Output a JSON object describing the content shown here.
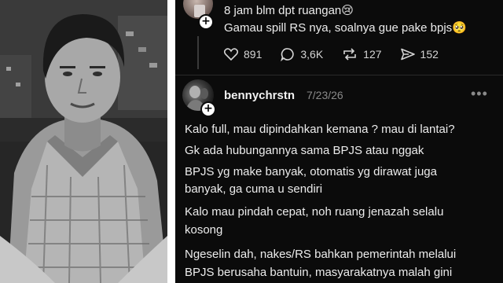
{
  "photo": {
    "description_icon": "man-portrait-photo"
  },
  "prev_comment": {
    "line1": "8 jam blm dpt ruangan😢",
    "line2": "Gamau spill RS nya, soalnya gue pake bpjs🥺",
    "likes": "891",
    "replies": "3,6K",
    "reposts": "127",
    "shares": "152"
  },
  "reply": {
    "username": "bennychrstn",
    "date": "7/23/26",
    "more_label": "•••",
    "lines": [
      "Kalo full, mau dipindahkan kemana ? mau di lantai?",
      "Gk ada hubungannya sama BPJS atau nggak",
      "BPJS yg make banyak, otomatis yg dirawat juga",
      "banyak, ga cuma u sendiri",
      "Kalo mau pindah cepat, noh ruang jenazah selalu",
      "kosong",
      "Ngeselin dah, nakes/RS bahkan pemerintah melalui",
      "BPJS berusaha bantuin, masyarakatnya malah gini"
    ]
  },
  "plus_label": "+",
  "colors": {
    "background": "#0b0b0b",
    "text": "#ececec",
    "muted": "#8a8a8a"
  }
}
